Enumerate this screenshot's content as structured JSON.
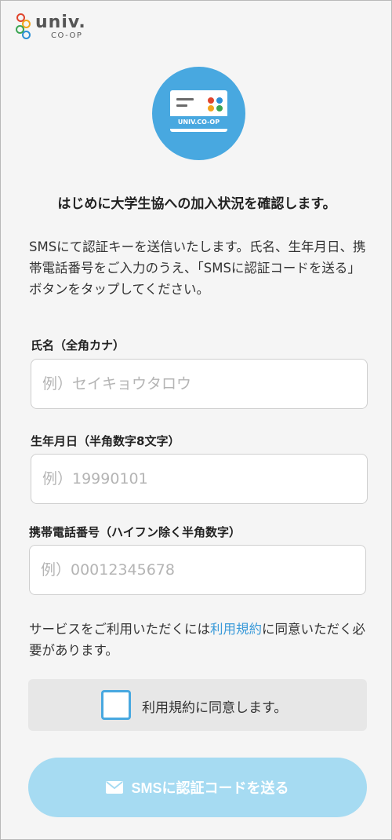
{
  "header": {
    "logo_word": "univ.",
    "logo_sub": "CO-OP"
  },
  "hero": {
    "card_caption": "UNIV.CO-OP"
  },
  "page_title": "はじめに大学生協への加入状況を確認します。",
  "description": "SMSにて認証キーを送信いたします。氏名、生年月日、携帯電話番号をご入力のうえ、「SMSに認証コードを送る」ボタンをタップしてください。",
  "form": {
    "name": {
      "label": "氏名（全角カナ）",
      "placeholder": "例）セイキョウタロウ",
      "value": ""
    },
    "birthdate": {
      "label": "生年月日（半角数字8文字）",
      "placeholder": "例）19990101",
      "value": ""
    },
    "phone": {
      "label": "携帯電話番号（ハイフン除く半角数字）",
      "placeholder": "例）00012345678",
      "value": ""
    }
  },
  "terms_notice": {
    "before": "サービスをご利用いただくには",
    "link": "利用規約",
    "after": "に同意いただく必要があります。"
  },
  "agree": {
    "label": "利用規約に同意します。",
    "checked": false
  },
  "submit": {
    "label": "SMSに認証コードを送る",
    "icon": "mail-icon"
  },
  "colors": {
    "accent": "#48a8e0",
    "button_disabled": "#a6dbf2",
    "link": "#3a9ad9",
    "background": "#f5f5f5"
  }
}
